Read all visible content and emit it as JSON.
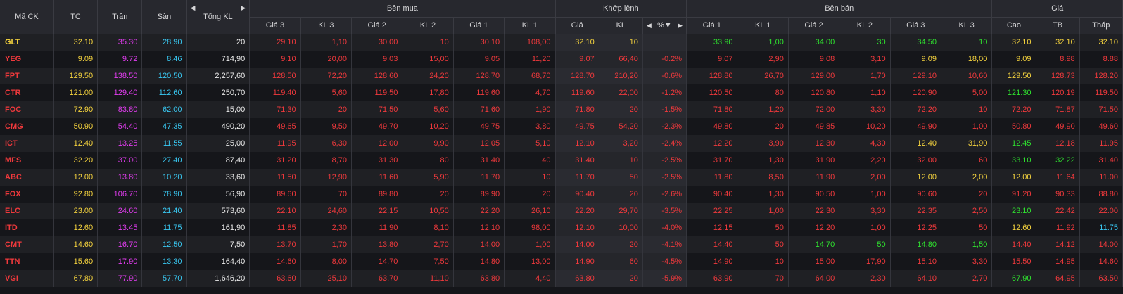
{
  "headers": {
    "symbol": "Mã CK",
    "ref": "TC",
    "ceil": "Trần",
    "floor": "Sàn",
    "total_vol": "Tổng KL",
    "buy_group": "Bên mua",
    "match_group": "Khớp lệnh",
    "sell_group": "Bên bán",
    "price_group": "Giá",
    "buy_cols": [
      "Giá 3",
      "KL 3",
      "Giá 2",
      "KL 2",
      "Giá 1",
      "KL 1"
    ],
    "match_cols": [
      "Giá",
      "KL",
      "%"
    ],
    "sell_cols": [
      "Giá 1",
      "KL 1",
      "Giá 2",
      "KL 2",
      "Giá 3",
      "KL 3"
    ],
    "price_cols": [
      "Cao",
      "TB",
      "Thấp"
    ]
  },
  "colors": {
    "ref": "#f5d33e",
    "ceil": "#e23cf0",
    "floor": "#39c8f2",
    "up": "#2fe02f",
    "down": "#f0393c",
    "neutral": "#e8e8e8"
  },
  "rows": [
    {
      "cells": [
        "GLT",
        "32.10",
        "35.30",
        "28.90",
        "20",
        "29.10",
        "1,10",
        "30.00",
        "10",
        "30.10",
        "108,00",
        "32.10",
        "10",
        "",
        "33.90",
        "1,00",
        "34.00",
        "30",
        "34.50",
        "10",
        "32.10",
        "32.10",
        "32.10"
      ],
      "colors": [
        "y",
        "y",
        "m",
        "c",
        "w",
        "r",
        "r",
        "r",
        "r",
        "r",
        "r",
        "y",
        "y",
        "y",
        "g",
        "g",
        "g",
        "g",
        "g",
        "g",
        "y",
        "y",
        "y"
      ]
    },
    {
      "cells": [
        "YEG",
        "9.09",
        "9.72",
        "8.46",
        "714,90",
        "9.10",
        "20,00",
        "9.03",
        "15,00",
        "9.05",
        "11,20",
        "9.07",
        "66,40",
        "-0.2%",
        "9.07",
        "2,90",
        "9.08",
        "3,10",
        "9.09",
        "18,00",
        "9.09",
        "8.98",
        "8.88"
      ],
      "colors": [
        "r",
        "y",
        "m",
        "c",
        "w",
        "r",
        "r",
        "r",
        "r",
        "r",
        "r",
        "r",
        "r",
        "r",
        "r",
        "r",
        "r",
        "r",
        "y",
        "y",
        "y",
        "r",
        "r"
      ]
    },
    {
      "cells": [
        "FPT",
        "129.50",
        "138.50",
        "120.50",
        "2,257,60",
        "128.50",
        "72,20",
        "128.60",
        "24,20",
        "128.70",
        "68,70",
        "128.70",
        "210,20",
        "-0.6%",
        "128.80",
        "26,70",
        "129.00",
        "1,70",
        "129.10",
        "10,60",
        "129.50",
        "128.73",
        "128.20"
      ],
      "colors": [
        "r",
        "y",
        "m",
        "c",
        "w",
        "r",
        "r",
        "r",
        "r",
        "r",
        "r",
        "r",
        "r",
        "r",
        "r",
        "r",
        "r",
        "r",
        "r",
        "r",
        "y",
        "r",
        "r"
      ]
    },
    {
      "cells": [
        "CTR",
        "121.00",
        "129.40",
        "112.60",
        "250,70",
        "119.40",
        "5,60",
        "119.50",
        "17,80",
        "119.60",
        "4,70",
        "119.60",
        "22,00",
        "-1.2%",
        "120.50",
        "80",
        "120.80",
        "1,10",
        "120.90",
        "5,00",
        "121.30",
        "120.19",
        "119.50"
      ],
      "colors": [
        "r",
        "y",
        "m",
        "c",
        "w",
        "r",
        "r",
        "r",
        "r",
        "r",
        "r",
        "r",
        "r",
        "r",
        "r",
        "r",
        "r",
        "r",
        "r",
        "r",
        "g",
        "r",
        "r"
      ]
    },
    {
      "cells": [
        "FOC",
        "72.90",
        "83.80",
        "62.00",
        "15,00",
        "71.30",
        "20",
        "71.50",
        "5,60",
        "71.60",
        "1,90",
        "71.80",
        "20",
        "-1.5%",
        "71.80",
        "1,20",
        "72.00",
        "3,30",
        "72.20",
        "10",
        "72.20",
        "71.87",
        "71.50"
      ],
      "colors": [
        "r",
        "y",
        "m",
        "c",
        "w",
        "r",
        "r",
        "r",
        "r",
        "r",
        "r",
        "r",
        "r",
        "r",
        "r",
        "r",
        "r",
        "r",
        "r",
        "r",
        "r",
        "r",
        "r"
      ]
    },
    {
      "cells": [
        "CMG",
        "50.90",
        "54.40",
        "47.35",
        "490,20",
        "49.65",
        "9,50",
        "49.70",
        "10,20",
        "49.75",
        "3,80",
        "49.75",
        "54,20",
        "-2.3%",
        "49.80",
        "20",
        "49.85",
        "10,20",
        "49.90",
        "1,00",
        "50.80",
        "49.90",
        "49.60"
      ],
      "colors": [
        "r",
        "y",
        "m",
        "c",
        "w",
        "r",
        "r",
        "r",
        "r",
        "r",
        "r",
        "r",
        "r",
        "r",
        "r",
        "r",
        "r",
        "r",
        "r",
        "r",
        "r",
        "r",
        "r"
      ]
    },
    {
      "cells": [
        "ICT",
        "12.40",
        "13.25",
        "11.55",
        "25,00",
        "11.95",
        "6,30",
        "12.00",
        "9,90",
        "12.05",
        "5,10",
        "12.10",
        "3,20",
        "-2.4%",
        "12.20",
        "3,90",
        "12.30",
        "4,30",
        "12.40",
        "31,90",
        "12.45",
        "12.18",
        "11.95"
      ],
      "colors": [
        "r",
        "y",
        "m",
        "c",
        "w",
        "r",
        "r",
        "r",
        "r",
        "r",
        "r",
        "r",
        "r",
        "r",
        "r",
        "r",
        "r",
        "r",
        "y",
        "y",
        "g",
        "r",
        "r"
      ]
    },
    {
      "cells": [
        "MFS",
        "32.20",
        "37.00",
        "27.40",
        "87,40",
        "31.20",
        "8,70",
        "31.30",
        "80",
        "31.40",
        "40",
        "31.40",
        "10",
        "-2.5%",
        "31.70",
        "1,30",
        "31.90",
        "2,20",
        "32.00",
        "60",
        "33.10",
        "32.22",
        "31.40"
      ],
      "colors": [
        "r",
        "y",
        "m",
        "c",
        "w",
        "r",
        "r",
        "r",
        "r",
        "r",
        "r",
        "r",
        "r",
        "r",
        "r",
        "r",
        "r",
        "r",
        "r",
        "r",
        "g",
        "g",
        "r"
      ]
    },
    {
      "cells": [
        "ABC",
        "12.00",
        "13.80",
        "10.20",
        "33,60",
        "11.50",
        "12,90",
        "11.60",
        "5,90",
        "11.70",
        "10",
        "11.70",
        "50",
        "-2.5%",
        "11.80",
        "8,50",
        "11.90",
        "2,00",
        "12.00",
        "2,00",
        "12.00",
        "11.64",
        "11.00"
      ],
      "colors": [
        "r",
        "y",
        "m",
        "c",
        "w",
        "r",
        "r",
        "r",
        "r",
        "r",
        "r",
        "r",
        "r",
        "r",
        "r",
        "r",
        "r",
        "r",
        "y",
        "y",
        "y",
        "r",
        "r"
      ]
    },
    {
      "cells": [
        "FOX",
        "92.80",
        "106.70",
        "78.90",
        "56,90",
        "89.60",
        "70",
        "89.80",
        "20",
        "89.90",
        "20",
        "90.40",
        "20",
        "-2.6%",
        "90.40",
        "1,30",
        "90.50",
        "1,00",
        "90.60",
        "20",
        "91.20",
        "90.33",
        "88.80"
      ],
      "colors": [
        "r",
        "y",
        "m",
        "c",
        "w",
        "r",
        "r",
        "r",
        "r",
        "r",
        "r",
        "r",
        "r",
        "r",
        "r",
        "r",
        "r",
        "r",
        "r",
        "r",
        "r",
        "r",
        "r"
      ]
    },
    {
      "cells": [
        "ELC",
        "23.00",
        "24.60",
        "21.40",
        "573,60",
        "22.10",
        "24,60",
        "22.15",
        "10,50",
        "22.20",
        "26,10",
        "22.20",
        "29,70",
        "-3.5%",
        "22.25",
        "1,00",
        "22.30",
        "3,30",
        "22.35",
        "2,50",
        "23.10",
        "22.42",
        "22.00"
      ],
      "colors": [
        "r",
        "y",
        "m",
        "c",
        "w",
        "r",
        "r",
        "r",
        "r",
        "r",
        "r",
        "r",
        "r",
        "r",
        "r",
        "r",
        "r",
        "r",
        "r",
        "r",
        "g",
        "r",
        "r"
      ]
    },
    {
      "cells": [
        "ITD",
        "12.60",
        "13.45",
        "11.75",
        "161,90",
        "11.85",
        "2,30",
        "11.90",
        "8,10",
        "12.10",
        "98,00",
        "12.10",
        "10,00",
        "-4.0%",
        "12.15",
        "50",
        "12.20",
        "1,00",
        "12.25",
        "50",
        "12.60",
        "11.92",
        "11.75"
      ],
      "colors": [
        "r",
        "y",
        "m",
        "c",
        "w",
        "r",
        "r",
        "r",
        "r",
        "r",
        "r",
        "r",
        "r",
        "r",
        "r",
        "r",
        "r",
        "r",
        "r",
        "r",
        "y",
        "r",
        "c"
      ]
    },
    {
      "cells": [
        "CMT",
        "14.60",
        "16.70",
        "12.50",
        "7,50",
        "13.70",
        "1,70",
        "13.80",
        "2,70",
        "14.00",
        "1,00",
        "14.00",
        "20",
        "-4.1%",
        "14.40",
        "50",
        "14.70",
        "50",
        "14.80",
        "1,50",
        "14.40",
        "14.12",
        "14.00"
      ],
      "colors": [
        "r",
        "y",
        "m",
        "c",
        "w",
        "r",
        "r",
        "r",
        "r",
        "r",
        "r",
        "r",
        "r",
        "r",
        "r",
        "r",
        "g",
        "g",
        "g",
        "g",
        "r",
        "r",
        "r"
      ]
    },
    {
      "cells": [
        "TTN",
        "15.60",
        "17.90",
        "13.30",
        "164,40",
        "14.60",
        "8,00",
        "14.70",
        "7,50",
        "14.80",
        "13,00",
        "14.90",
        "60",
        "-4.5%",
        "14.90",
        "10",
        "15.00",
        "17,90",
        "15.10",
        "3,30",
        "15.50",
        "14.95",
        "14.60"
      ],
      "colors": [
        "r",
        "y",
        "m",
        "c",
        "w",
        "r",
        "r",
        "r",
        "r",
        "r",
        "r",
        "r",
        "r",
        "r",
        "r",
        "r",
        "r",
        "r",
        "r",
        "r",
        "r",
        "r",
        "r"
      ]
    },
    {
      "cells": [
        "VGI",
        "67.80",
        "77.90",
        "57.70",
        "1,646,20",
        "63.60",
        "25,10",
        "63.70",
        "11,10",
        "63.80",
        "4,40",
        "63.80",
        "20",
        "-5.9%",
        "63.90",
        "70",
        "64.00",
        "2,30",
        "64.10",
        "2,70",
        "67.90",
        "64.95",
        "63.50"
      ],
      "colors": [
        "r",
        "y",
        "m",
        "c",
        "w",
        "r",
        "r",
        "r",
        "r",
        "r",
        "r",
        "r",
        "r",
        "r",
        "r",
        "r",
        "r",
        "r",
        "r",
        "r",
        "g",
        "r",
        "r"
      ]
    }
  ]
}
